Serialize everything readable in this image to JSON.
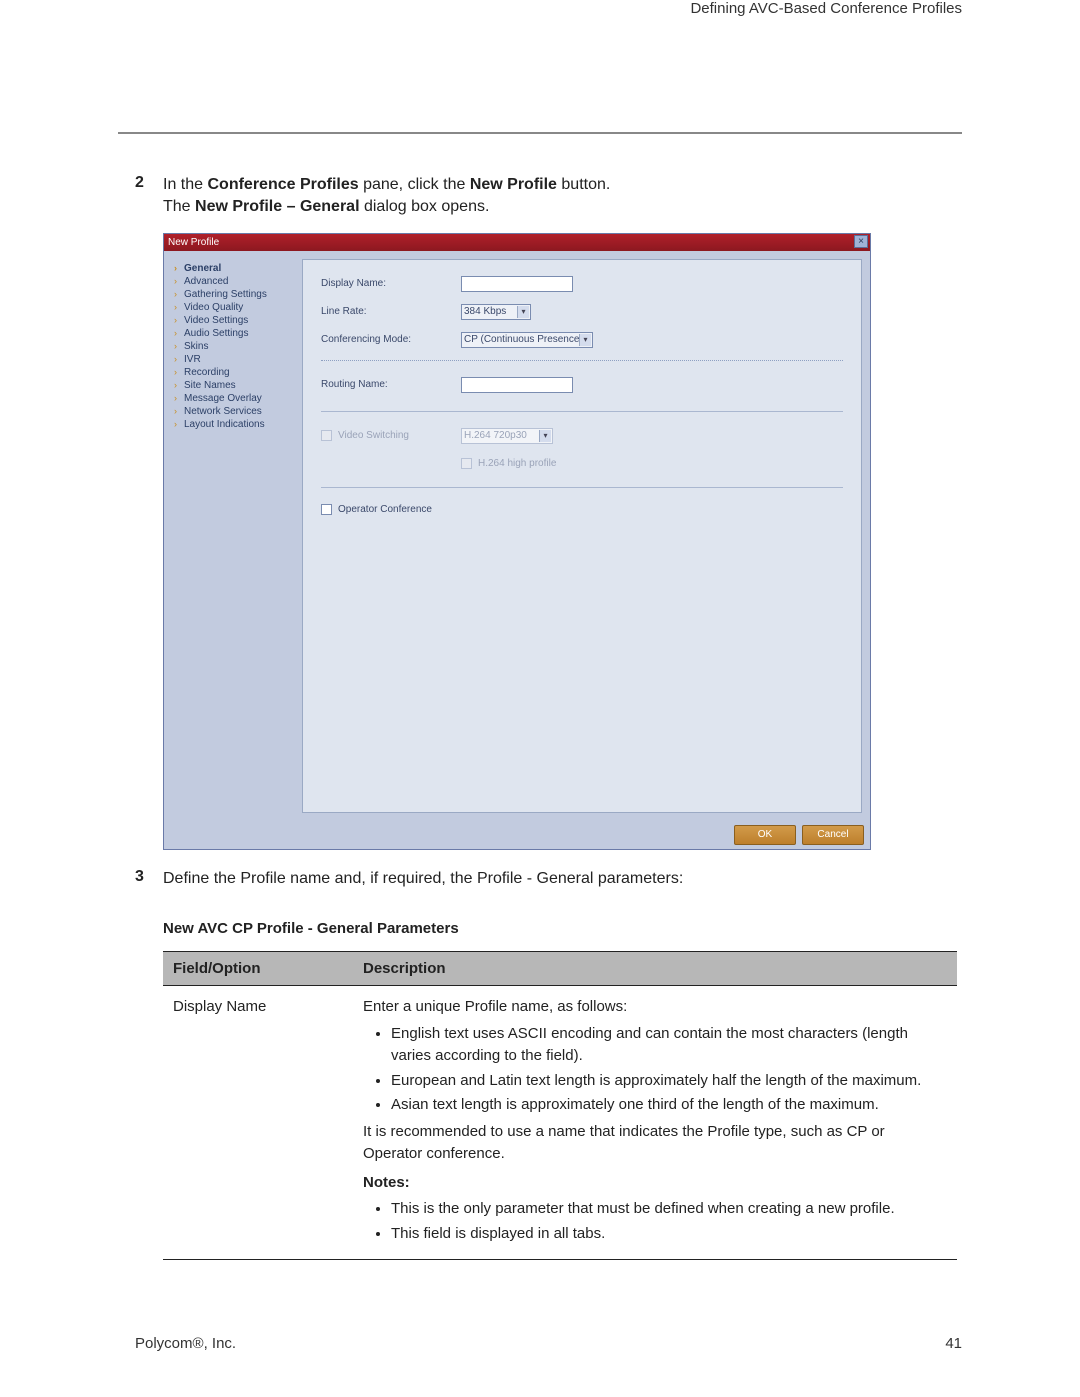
{
  "header": {
    "section_title": "Defining AVC-Based Conference Profiles"
  },
  "steps": {
    "s2": {
      "num": "2",
      "pre": "In the ",
      "bold1": "Conference Profiles",
      "mid1": " pane, click the ",
      "bold2": "New Profile",
      "post1": " button.",
      "line2_pre": "The ",
      "line2_bold": "New Profile – General",
      "line2_post": " dialog box opens."
    },
    "s3": {
      "num": "3",
      "text": "Define the Profile name and, if required, the Profile - General parameters:"
    }
  },
  "dialog": {
    "title": "New Profile",
    "sidebar": [
      "General",
      "Advanced",
      "Gathering Settings",
      "Video Quality",
      "Video Settings",
      "Audio Settings",
      "Skins",
      "IVR",
      "Recording",
      "Site Names",
      "Message Overlay",
      "Network Services",
      "Layout Indications"
    ],
    "fields": {
      "display_name_label": "Display Name:",
      "display_name_value": "",
      "line_rate_label": "Line Rate:",
      "line_rate_value": "384 Kbps",
      "conf_mode_label": "Conferencing Mode:",
      "conf_mode_value": "CP (Continuous Presence)",
      "routing_name_label": "Routing Name:",
      "routing_name_value": "",
      "video_switching_label": "Video Switching",
      "video_switching_select": "H.264 720p30",
      "h264_high_label": "H.264 high profile",
      "operator_conf_label": "Operator Conference"
    },
    "buttons": {
      "ok": "OK",
      "cancel": "Cancel"
    }
  },
  "table": {
    "title": "New AVC CP Profile - General Parameters",
    "col1": "Field/Option",
    "col2": "Description",
    "row1": {
      "field": "Display Name",
      "intro": "Enter a unique Profile name, as follows:",
      "bullets": [
        "English text uses ASCII encoding and can contain the most characters (length varies according to the field).",
        "European and Latin text length is approximately half the length of the maximum.",
        "Asian text length is approximately one third of the length of the maximum."
      ],
      "rec": "It is recommended to use a name that indicates the Profile type, such as CP or Operator conference.",
      "notes_label": "Notes:",
      "notes": [
        "This is the only parameter that must be defined when creating a new profile.",
        "This field is displayed in all tabs."
      ]
    }
  },
  "footer": {
    "left": "Polycom®, Inc.",
    "right": "41"
  }
}
